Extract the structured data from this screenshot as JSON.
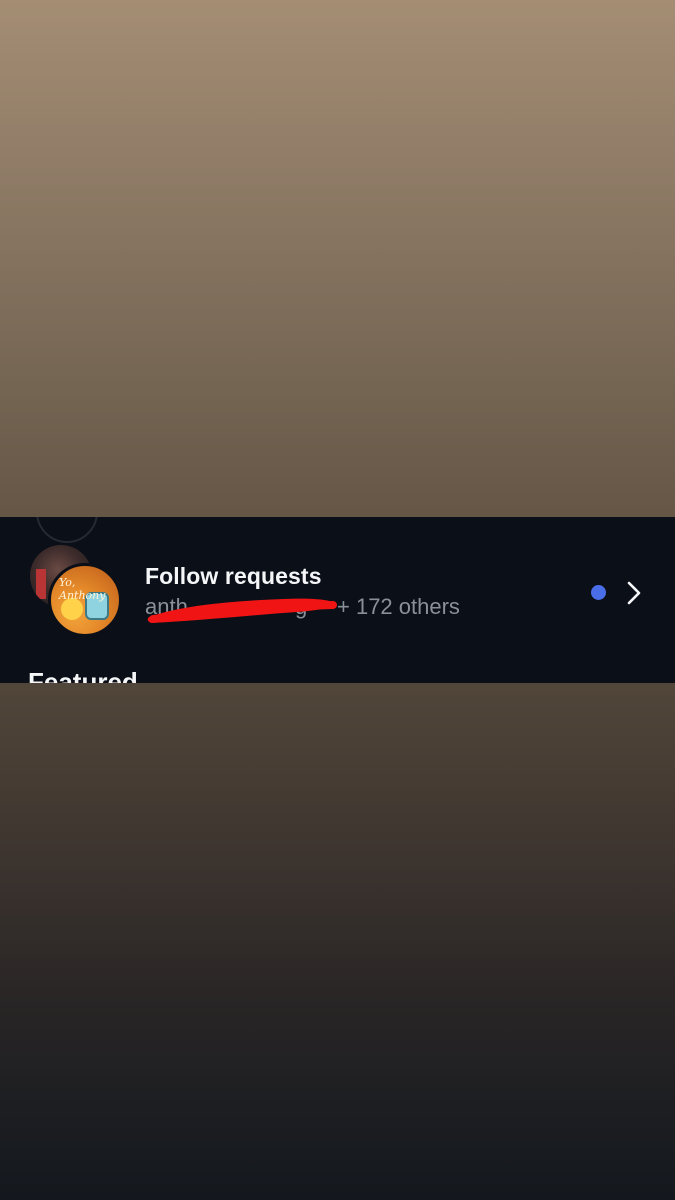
{
  "follow_requests": {
    "title": "Follow requests",
    "username_start": "anth",
    "username_end": "g",
    "others_text": "+ 172 others",
    "has_unread": true,
    "accent_color": "#4a6ee8"
  },
  "avatar_overlay_text": "Yo, Anthony",
  "section": {
    "heading": "Featured"
  },
  "icons": {
    "chevron": "chevron-right-icon",
    "unread": "unread-dot-icon"
  }
}
